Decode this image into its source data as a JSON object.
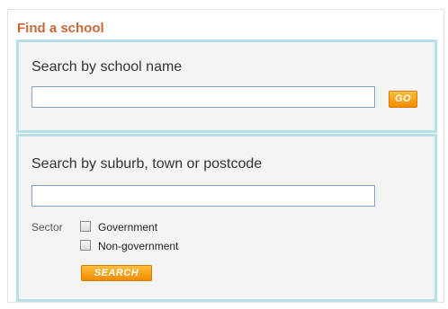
{
  "widget": {
    "title": "Find a school"
  },
  "name_search": {
    "heading": "Search by school name",
    "input_value": "",
    "go_label": "GO"
  },
  "area_search": {
    "heading": "Search by suburb, town or postcode",
    "input_value": "",
    "sector_label": "Sector",
    "options": [
      {
        "label": "Government",
        "checked": false
      },
      {
        "label": "Non-government",
        "checked": false
      }
    ],
    "search_label": "SEARCH"
  },
  "colors": {
    "title": "#c8693a",
    "panel_border": "#b7e0e8",
    "panel_background": "#f4f4f4",
    "button": "#f28a00"
  }
}
